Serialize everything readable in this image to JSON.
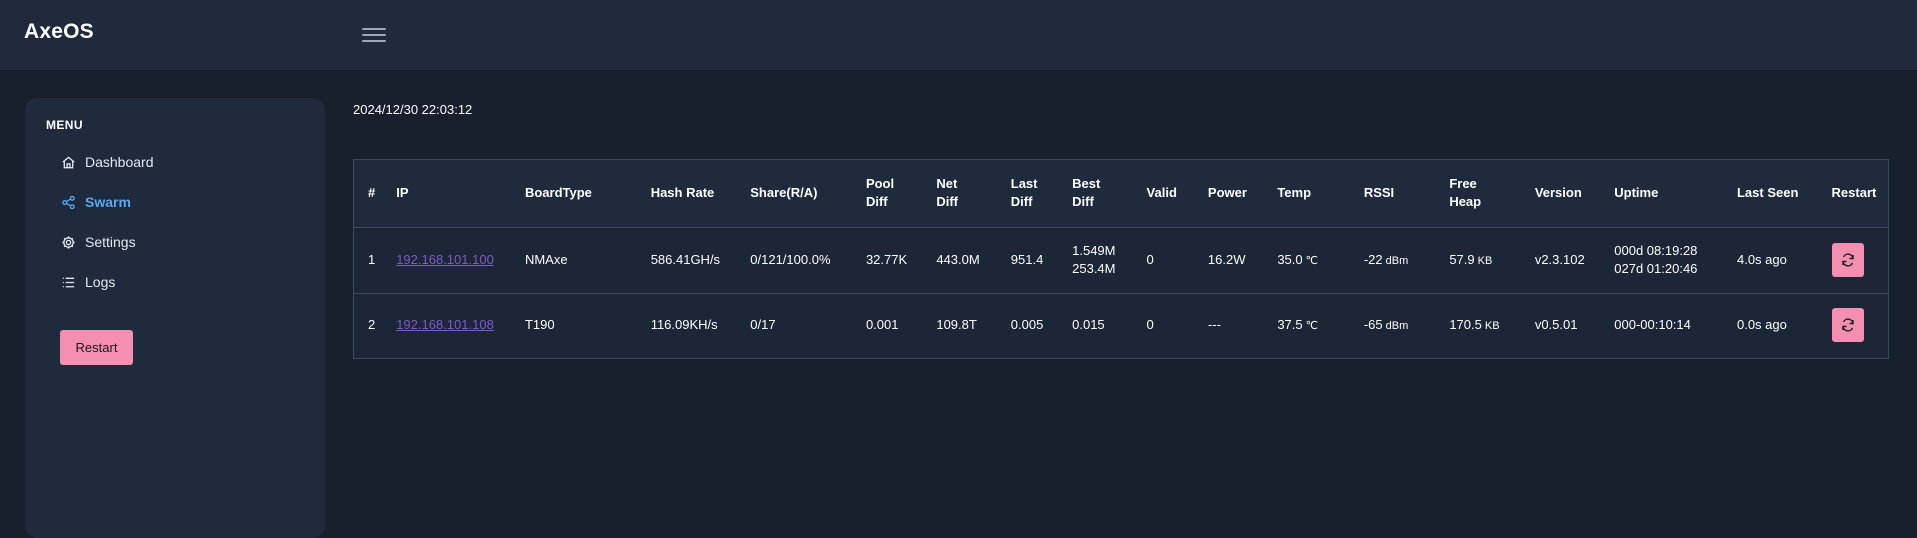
{
  "header": {
    "brand": "AxeOS"
  },
  "sidebar": {
    "menu_title": "MENU",
    "items": [
      {
        "label": "Dashboard",
        "icon": "home-icon"
      },
      {
        "label": "Swarm",
        "icon": "share-icon",
        "active": true
      },
      {
        "label": "Settings",
        "icon": "gear-icon"
      },
      {
        "label": "Logs",
        "icon": "list-icon"
      }
    ],
    "restart_label": "Restart"
  },
  "main": {
    "timestamp": "2024/12/30 22:03:12",
    "table": {
      "headers": {
        "num": "#",
        "ip": "IP",
        "boardtype": "BoardType",
        "hashrate": "Hash Rate",
        "shares": "Share(R/A)",
        "pooldiff_1": "Pool",
        "pooldiff_2": "Diff",
        "netdiff_1": "Net",
        "netdiff_2": "Diff",
        "lastdiff_1": "Last",
        "lastdiff_2": "Diff",
        "bestdiff_1": "Best",
        "bestdiff_2": "Diff",
        "valid": "Valid",
        "power": "Power",
        "temp": "Temp",
        "rssi": "RSSI",
        "freeheap_1": "Free",
        "freeheap_2": "Heap",
        "version": "Version",
        "uptime": "Uptime",
        "lastseen": "Last Seen",
        "restart": "Restart"
      },
      "rows": [
        {
          "num": "1",
          "ip": "192.168.101.100",
          "boardtype": "NMAxe",
          "hashrate": "586.41GH/s",
          "shares": "0/121/100.0%",
          "pooldiff": "32.77K",
          "netdiff": "443.0M",
          "lastdiff": "951.4",
          "bestdiff_1": "1.549M",
          "bestdiff_2": "253.4M",
          "valid": "0",
          "power": "16.2W",
          "temp": "35.0",
          "temp_unit": "℃",
          "rssi": "-22",
          "rssi_unit": "dBm",
          "freeheap": "57.9",
          "freeheap_unit": "KB",
          "version": "v2.3.102",
          "uptime_1": "000d 08:19:28",
          "uptime_2": "027d 01:20:46",
          "lastseen": "4.0s ago"
        },
        {
          "num": "2",
          "ip": "192.168.101.108",
          "boardtype": "T190",
          "hashrate": "116.09KH/s",
          "shares": "0/17",
          "pooldiff": "0.001",
          "netdiff": "109.8T",
          "lastdiff": "0.005",
          "bestdiff_1": "0.015",
          "bestdiff_2": "",
          "valid": "0",
          "power": "---",
          "temp": "37.5",
          "temp_unit": "℃",
          "rssi": "-65",
          "rssi_unit": "dBm",
          "freeheap": "170.5",
          "freeheap_unit": "KB",
          "version": "v0.5.01",
          "uptime_1": "000-00:10:14",
          "uptime_2": "",
          "lastseen": "0.0s ago"
        }
      ]
    }
  },
  "colors": {
    "background": "#18202d",
    "panel": "#1f2a3d",
    "accent": "#5aa8f0",
    "button": "#f48fb1",
    "link": "#7c5cc4"
  }
}
